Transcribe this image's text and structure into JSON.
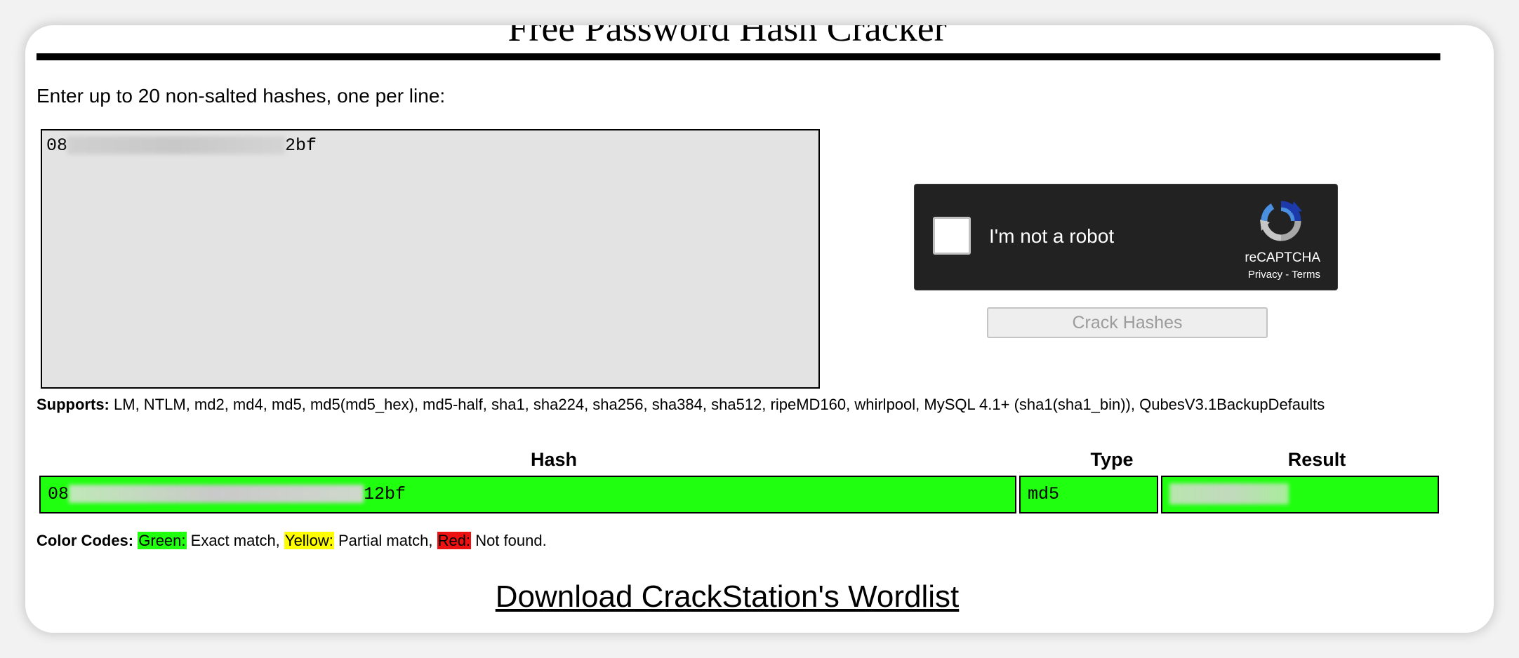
{
  "page": {
    "title": "Free Password Hash Cracker",
    "instructions": "Enter up to 20 non-salted hashes, one per line:"
  },
  "hash_input": {
    "visible_prefix": "08",
    "visible_suffix": "2bf"
  },
  "recaptcha": {
    "label": "I'm not a robot",
    "brand": "reCAPTCHA",
    "links": "Privacy - Terms",
    "logo_icon": "recaptcha-logo-icon"
  },
  "crack_button": {
    "label": "Crack Hashes"
  },
  "supports": {
    "label": "Supports:",
    "text": "LM, NTLM, md2, md4, md5, md5(md5_hex), md5-half, sha1, sha224, sha256, sha384, sha512, ripeMD160, whirlpool, MySQL 4.1+ (sha1(sha1_bin)), QubesV3.1BackupDefaults"
  },
  "results_table": {
    "headers": [
      "Hash",
      "Type",
      "Result"
    ],
    "rows": [
      {
        "hash_prefix": "08",
        "hash_suffix": "12bf",
        "type": "md5",
        "status_color": "#1fff0f"
      }
    ]
  },
  "color_codes": {
    "label": "Color Codes:",
    "green_label": "Green:",
    "green_text": "Exact match,",
    "yellow_label": "Yellow:",
    "yellow_text": "Partial match,",
    "red_label": "Red:",
    "red_text": "Not found.",
    "colors": {
      "green": "#1fff0f",
      "yellow": "#ffff00",
      "red": "#ee1111"
    }
  },
  "download_link": {
    "label": "Download CrackStation's Wordlist"
  }
}
